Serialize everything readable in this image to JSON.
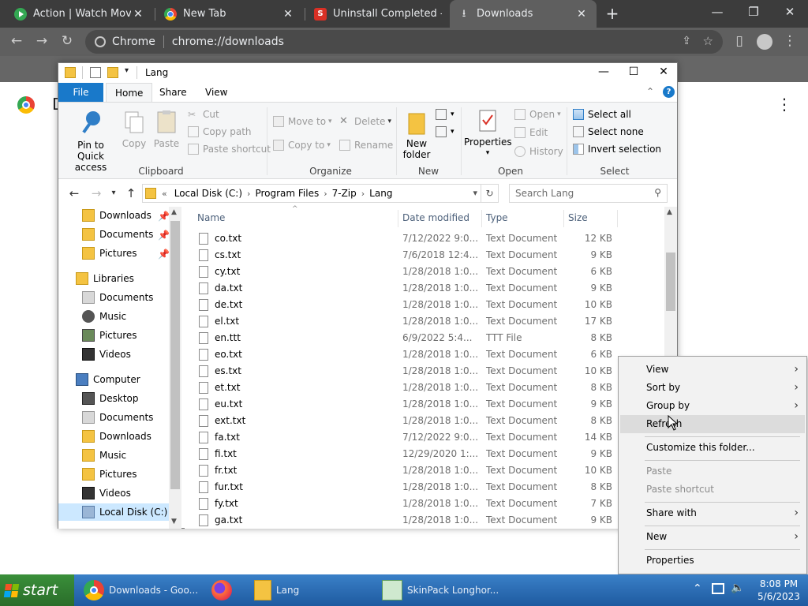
{
  "browser": {
    "tabs": [
      {
        "label": "Action | Watch Movie",
        "icon": "play-icon",
        "color": "#34a853"
      },
      {
        "label": "New Tab",
        "icon": "chrome-icon"
      },
      {
        "label": "Uninstall Completed -",
        "icon": "softpedia-icon",
        "color": "#d93025"
      },
      {
        "label": "Downloads",
        "icon": "download-icon"
      }
    ],
    "site_chip": "Chrome",
    "url": "chrome://downloads",
    "page_title_partial": "D"
  },
  "explorer": {
    "title": "Lang",
    "ribbon_tabs": [
      "File",
      "Home",
      "Share",
      "View"
    ],
    "clipboard": {
      "pin": "Pin to Quick access",
      "copy": "Copy",
      "paste": "Paste",
      "cut": "Cut",
      "copy_path": "Copy path",
      "paste_shortcut": "Paste shortcut",
      "label": "Clipboard"
    },
    "organize": {
      "move_to": "Move to",
      "copy_to": "Copy to",
      "delete": "Delete",
      "rename": "Rename",
      "label": "Organize"
    },
    "new": {
      "new_folder": "New folder",
      "label": "New"
    },
    "open": {
      "properties": "Properties",
      "open": "Open",
      "edit": "Edit",
      "history": "History",
      "label": "Open"
    },
    "select": {
      "select_all": "Select all",
      "select_none": "Select none",
      "invert": "Invert selection",
      "label": "Select"
    },
    "address": {
      "overflow": "«",
      "crumbs": [
        "Local Disk (C:)",
        "Program Files",
        "7-Zip",
        "Lang"
      ]
    },
    "search_placeholder": "Search Lang",
    "nav": {
      "quick": [
        "Downloads",
        "Documents",
        "Pictures"
      ],
      "libraries_label": "Libraries",
      "libraries": [
        "Documents",
        "Music",
        "Pictures",
        "Videos"
      ],
      "computer_label": "Computer",
      "computer": [
        "Desktop",
        "Documents",
        "Downloads",
        "Music",
        "Pictures",
        "Videos",
        "Local Disk (C:)"
      ]
    },
    "columns": [
      "Name",
      "Date modified",
      "Type",
      "Size"
    ],
    "files": [
      {
        "name": "co.txt",
        "date": "7/12/2022 9:0...",
        "type": "Text Document",
        "size": "12 KB"
      },
      {
        "name": "cs.txt",
        "date": "7/6/2018 12:4...",
        "type": "Text Document",
        "size": "9 KB"
      },
      {
        "name": "cy.txt",
        "date": "1/28/2018 1:0...",
        "type": "Text Document",
        "size": "6 KB"
      },
      {
        "name": "da.txt",
        "date": "1/28/2018 1:0...",
        "type": "Text Document",
        "size": "9 KB"
      },
      {
        "name": "de.txt",
        "date": "1/28/2018 1:0...",
        "type": "Text Document",
        "size": "10 KB"
      },
      {
        "name": "el.txt",
        "date": "1/28/2018 1:0...",
        "type": "Text Document",
        "size": "17 KB"
      },
      {
        "name": "en.ttt",
        "date": "6/9/2022 5:4...",
        "type": "TTT File",
        "size": "8 KB"
      },
      {
        "name": "eo.txt",
        "date": "1/28/2018 1:0...",
        "type": "Text Document",
        "size": "6 KB"
      },
      {
        "name": "es.txt",
        "date": "1/28/2018 1:0...",
        "type": "Text Document",
        "size": "10 KB"
      },
      {
        "name": "et.txt",
        "date": "1/28/2018 1:0...",
        "type": "Text Document",
        "size": "8 KB"
      },
      {
        "name": "eu.txt",
        "date": "1/28/2018 1:0...",
        "type": "Text Document",
        "size": "9 KB"
      },
      {
        "name": "ext.txt",
        "date": "1/28/2018 1:0...",
        "type": "Text Document",
        "size": "8 KB"
      },
      {
        "name": "fa.txt",
        "date": "7/12/2022 9:0...",
        "type": "Text Document",
        "size": "14 KB"
      },
      {
        "name": "fi.txt",
        "date": "12/29/2020 1:...",
        "type": "Text Document",
        "size": "9 KB"
      },
      {
        "name": "fr.txt",
        "date": "1/28/2018 1:0...",
        "type": "Text Document",
        "size": "10 KB"
      },
      {
        "name": "fur.txt",
        "date": "1/28/2018 1:0...",
        "type": "Text Document",
        "size": "8 KB"
      },
      {
        "name": "fy.txt",
        "date": "1/28/2018 1:0...",
        "type": "Text Document",
        "size": "7 KB"
      },
      {
        "name": "ga.txt",
        "date": "1/28/2018 1:0...",
        "type": "Text Document",
        "size": "9 KB"
      }
    ]
  },
  "context_menu": {
    "view": "View",
    "sort_by": "Sort by",
    "group_by": "Group by",
    "refresh": "Refresh",
    "customize": "Customize this folder...",
    "paste": "Paste",
    "paste_shortcut": "Paste shortcut",
    "share_with": "Share with",
    "new": "New",
    "properties": "Properties"
  },
  "taskbar": {
    "start": "start",
    "items": [
      {
        "label": "Downloads - Goo...",
        "icon": "chrome-icon"
      },
      {
        "label": "",
        "icon": "firefox-icon"
      },
      {
        "label": "Lang",
        "icon": "folder-icon"
      },
      {
        "label": "SkinPack Longhor...",
        "icon": "skinpack-icon"
      }
    ],
    "time": "8:08 PM",
    "date": "5/6/2023"
  },
  "colors": {
    "chrome_tabbar": "#3c3c3c",
    "chrome_toolbar": "#5f5f5f",
    "file_tab": "#1979ca",
    "nav_selected": "#cce8ff",
    "menu_hot": "#dcdcdc",
    "taskbar": "#2a6cb8",
    "start": "#2f7f2f"
  }
}
